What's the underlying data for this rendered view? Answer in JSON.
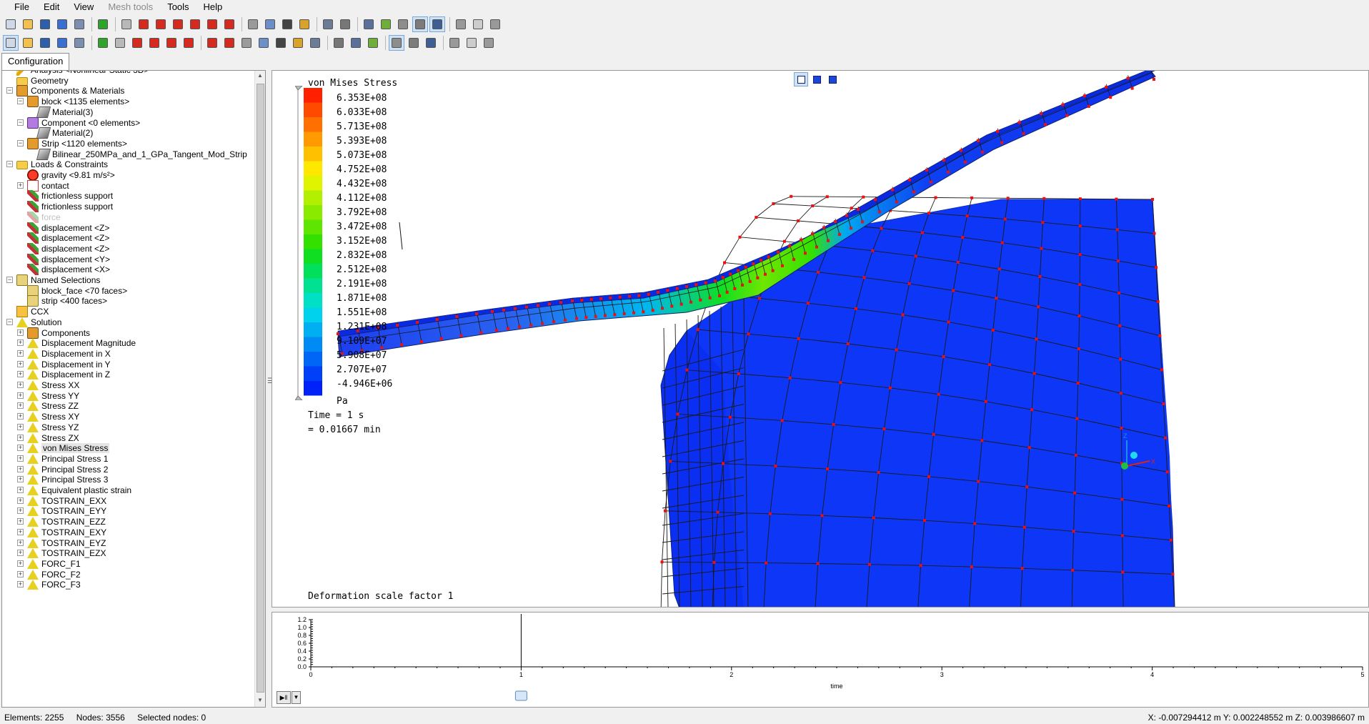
{
  "menu": {
    "items": [
      {
        "label": "File",
        "enabled": true
      },
      {
        "label": "Edit",
        "enabled": true
      },
      {
        "label": "View",
        "enabled": true
      },
      {
        "label": "Mesh tools",
        "enabled": false
      },
      {
        "label": "Tools",
        "enabled": true
      },
      {
        "label": "Help",
        "enabled": true
      }
    ]
  },
  "toolbar1": {
    "icons": [
      "new-file-icon",
      "open-folder-icon",
      "save-icon",
      "undo-icon",
      "redo-icon",
      "equal-bars-icon",
      "wireframe-cube-icon",
      "red-cube-icon",
      "red-cube-front-icon",
      "red-cube-top-icon",
      "red-cube-side-icon",
      "red-cube-iso-icon",
      "red-cube-bottom-icon",
      "zoom-window-icon",
      "zoom-icon",
      "rotate-icon",
      "zoom-fit-icon",
      "view-settings-icon",
      "arrow-dropdown-icon",
      "node-view-icon",
      "surface-icon",
      "shaded-icon",
      "shaded-edges-icon",
      "mesh-view-icon",
      "slider-left-icon",
      "slider-icon",
      "slider-right-icon"
    ]
  },
  "toolbar2": {
    "icons": [
      "select-pointer-icon",
      "pick-node-icon",
      "pick-element-icon",
      "pick-face-icon",
      "pick-body-icon",
      "explode-icon",
      "box-icon",
      "box-3d-icon",
      "cross-icon",
      "split-icon",
      "merge-icon",
      "move-icon",
      "copy-icon",
      "cylinder-icon",
      "arc-icon",
      "rotate-node-icon",
      "branch-icon",
      "scatter-icon",
      "mesh-triangle-icon",
      "triangle-icon",
      "triangle-outline-icon",
      "contour-icon",
      "contour-filled-icon",
      "contour-lines-icon",
      "grid-dropdown-icon",
      "arrows-icon",
      "table-icon"
    ]
  },
  "tabs": {
    "configuration": "Configuration"
  },
  "tree": [
    {
      "label": "Analysis <Nonlinear Static 3D>",
      "icon": "analysis-icon",
      "depth": 0,
      "expander": ""
    },
    {
      "label": "Geometry",
      "icon": "folder-icon",
      "depth": 0,
      "expander": ""
    },
    {
      "label": "Components & Materials",
      "icon": "components-icon",
      "depth": 0,
      "expander": "-"
    },
    {
      "label": "block <1135 elements>",
      "icon": "component-icon",
      "depth": 1,
      "expander": "-"
    },
    {
      "label": "Material(3)",
      "icon": "material-icon",
      "depth": 2,
      "expander": ""
    },
    {
      "label": "Component <0 elements>",
      "icon": "component-purple-icon",
      "depth": 1,
      "expander": "-"
    },
    {
      "label": "Material(2)",
      "icon": "material-icon",
      "depth": 2,
      "expander": ""
    },
    {
      "label": "Strip <1120 elements>",
      "icon": "component-icon",
      "depth": 1,
      "expander": "-"
    },
    {
      "label": "Bilinear_250MPa_and_1_GPa_Tangent_Mod_Strip",
      "icon": "material-icon",
      "depth": 2,
      "expander": ""
    },
    {
      "label": "Loads & Constraints",
      "icon": "loads-icon",
      "depth": 0,
      "expander": "-"
    },
    {
      "label": "gravity <9.81 m/s²>",
      "icon": "gravity-icon",
      "depth": 1,
      "expander": ""
    },
    {
      "label": "contact",
      "icon": "contact-icon",
      "depth": 1,
      "expander": "+"
    },
    {
      "label": "frictionless support",
      "icon": "support-icon",
      "depth": 1,
      "expander": ""
    },
    {
      "label": "frictionless support",
      "icon": "support-icon",
      "depth": 1,
      "expander": ""
    },
    {
      "label": "force",
      "icon": "support-icon",
      "depth": 1,
      "expander": "",
      "dim": true
    },
    {
      "label": "displacement <Z>",
      "icon": "support-icon",
      "depth": 1,
      "expander": ""
    },
    {
      "label": "displacement <Z>",
      "icon": "support-icon",
      "depth": 1,
      "expander": ""
    },
    {
      "label": "displacement <Z>",
      "icon": "support-icon",
      "depth": 1,
      "expander": ""
    },
    {
      "label": "displacement <Y>",
      "icon": "support-icon",
      "depth": 1,
      "expander": ""
    },
    {
      "label": "displacement <X>",
      "icon": "support-icon",
      "depth": 1,
      "expander": ""
    },
    {
      "label": "Named Selections",
      "icon": "named-selections-icon",
      "depth": 0,
      "expander": "-"
    },
    {
      "label": "block_face <70 faces>",
      "icon": "named-selection-icon",
      "depth": 1,
      "expander": ""
    },
    {
      "label": "strip <400 faces>",
      "icon": "named-selection-icon",
      "depth": 1,
      "expander": ""
    },
    {
      "label": "CCX",
      "icon": "ccx-icon",
      "depth": 0,
      "expander": ""
    },
    {
      "label": "Solution",
      "icon": "solution-icon",
      "depth": 0,
      "expander": "-"
    },
    {
      "label": "Components",
      "icon": "components-icon",
      "depth": 1,
      "expander": "+"
    },
    {
      "label": "Displacement Magnitude",
      "icon": "solution-icon",
      "depth": 1,
      "expander": "+"
    },
    {
      "label": "Displacement in X",
      "icon": "solution-icon",
      "depth": 1,
      "expander": "+"
    },
    {
      "label": "Displacement in Y",
      "icon": "solution-icon",
      "depth": 1,
      "expander": "+"
    },
    {
      "label": "Displacement in Z",
      "icon": "solution-icon",
      "depth": 1,
      "expander": "+"
    },
    {
      "label": "Stress XX",
      "icon": "solution-icon",
      "depth": 1,
      "expander": "+"
    },
    {
      "label": "Stress YY",
      "icon": "solution-icon",
      "depth": 1,
      "expander": "+"
    },
    {
      "label": "Stress ZZ",
      "icon": "solution-icon",
      "depth": 1,
      "expander": "+"
    },
    {
      "label": "Stress XY",
      "icon": "solution-icon",
      "depth": 1,
      "expander": "+"
    },
    {
      "label": "Stress YZ",
      "icon": "solution-icon",
      "depth": 1,
      "expander": "+"
    },
    {
      "label": "Stress ZX",
      "icon": "solution-icon",
      "depth": 1,
      "expander": "+"
    },
    {
      "label": "von Mises Stress",
      "icon": "solution-icon",
      "depth": 1,
      "expander": "+",
      "selected": true
    },
    {
      "label": "Principal Stress 1",
      "icon": "solution-icon",
      "depth": 1,
      "expander": "+"
    },
    {
      "label": "Principal Stress 2",
      "icon": "solution-icon",
      "depth": 1,
      "expander": "+"
    },
    {
      "label": "Principal Stress 3",
      "icon": "solution-icon",
      "depth": 1,
      "expander": "+"
    },
    {
      "label": "Equivalent plastic strain",
      "icon": "solution-icon",
      "depth": 1,
      "expander": "+"
    },
    {
      "label": "TOSTRAIN_EXX",
      "icon": "solution-icon",
      "depth": 1,
      "expander": "+"
    },
    {
      "label": "TOSTRAIN_EYY",
      "icon": "solution-icon",
      "depth": 1,
      "expander": "+"
    },
    {
      "label": "TOSTRAIN_EZZ",
      "icon": "solution-icon",
      "depth": 1,
      "expander": "+"
    },
    {
      "label": "TOSTRAIN_EXY",
      "icon": "solution-icon",
      "depth": 1,
      "expander": "+"
    },
    {
      "label": "TOSTRAIN_EYZ",
      "icon": "solution-icon",
      "depth": 1,
      "expander": "+"
    },
    {
      "label": "TOSTRAIN_EZX",
      "icon": "solution-icon",
      "depth": 1,
      "expander": "+"
    },
    {
      "label": "FORC_F1",
      "icon": "solution-icon",
      "depth": 1,
      "expander": "+"
    },
    {
      "label": "FORC_F2",
      "icon": "solution-icon",
      "depth": 1,
      "expander": "+"
    },
    {
      "label": "FORC_F3",
      "icon": "solution-icon",
      "depth": 1,
      "expander": "+"
    }
  ],
  "legend": {
    "title": "von Mises Stress",
    "values": [
      "6.353E+08",
      "6.033E+08",
      "5.713E+08",
      "5.393E+08",
      "5.073E+08",
      "4.752E+08",
      "4.432E+08",
      "4.112E+08",
      "3.792E+08",
      "3.472E+08",
      "3.152E+08",
      "2.832E+08",
      "2.512E+08",
      "2.191E+08",
      "1.871E+08",
      "1.551E+08",
      "1.231E+08",
      "9.109E+07",
      "5.908E+07",
      "2.707E+07",
      "-4.946E+06"
    ],
    "colors": [
      "#ff2000",
      "#ff4a00",
      "#ff7000",
      "#ff9a00",
      "#ffc000",
      "#ffe800",
      "#e0f400",
      "#b2ef00",
      "#8aeb00",
      "#5ee500",
      "#34e000",
      "#10de22",
      "#00e05a",
      "#00e292",
      "#00e0c4",
      "#00d2ee",
      "#00aef2",
      "#008af4",
      "#0066f6",
      "#0040f8",
      "#0022f8"
    ],
    "unit": "Pa",
    "time": "Time = 1 s",
    "time_min": "= 0.01667 min"
  },
  "viewport": {
    "deformation": "Deformation scale factor 1",
    "view_buttons": [
      "view-iso-icon",
      "view-solid-icon",
      "view-shaded-icon"
    ]
  },
  "timeline": {
    "y_ticks": [
      "1.2",
      "1.0",
      "0.8",
      "0.6",
      "0.4",
      "0.2",
      "0.0"
    ],
    "x_ticks": [
      "0",
      "1",
      "2",
      "3",
      "4",
      "5"
    ],
    "x_label": "time",
    "current_time": 1
  },
  "status": {
    "elements": "Elements: 2255",
    "nodes": "Nodes: 3556",
    "selected": "Selected nodes: 0",
    "coords": "X: -0.007294412 m Y: 0.002248552 m Z: 0.003986607 m"
  }
}
